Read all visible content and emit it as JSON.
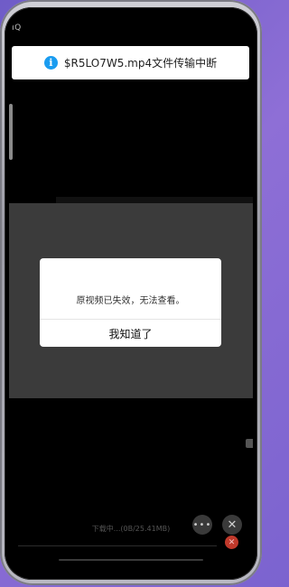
{
  "status_bar": {
    "text": "IQ"
  },
  "notification": {
    "icon": "info-icon",
    "icon_glyph": "i",
    "text": "$R5LO7W5.mp4文件传输中断"
  },
  "dialog": {
    "message": "原视频已失效，无法查看。",
    "confirm_label": "我知道了"
  },
  "download": {
    "progress_text": "下载中...(0B/25.41MB)"
  },
  "controls": {
    "more_icon": "more-icon",
    "more_glyph": "•••",
    "close_icon": "close-icon",
    "close_glyph": "✕",
    "cancel_icon": "cancel-icon",
    "cancel_glyph": "✕"
  },
  "colors": {
    "info_blue": "#1a9cf0",
    "cancel_red": "#c0392b",
    "dialog_bg": "#ffffff",
    "screen_bg": "#000000"
  }
}
